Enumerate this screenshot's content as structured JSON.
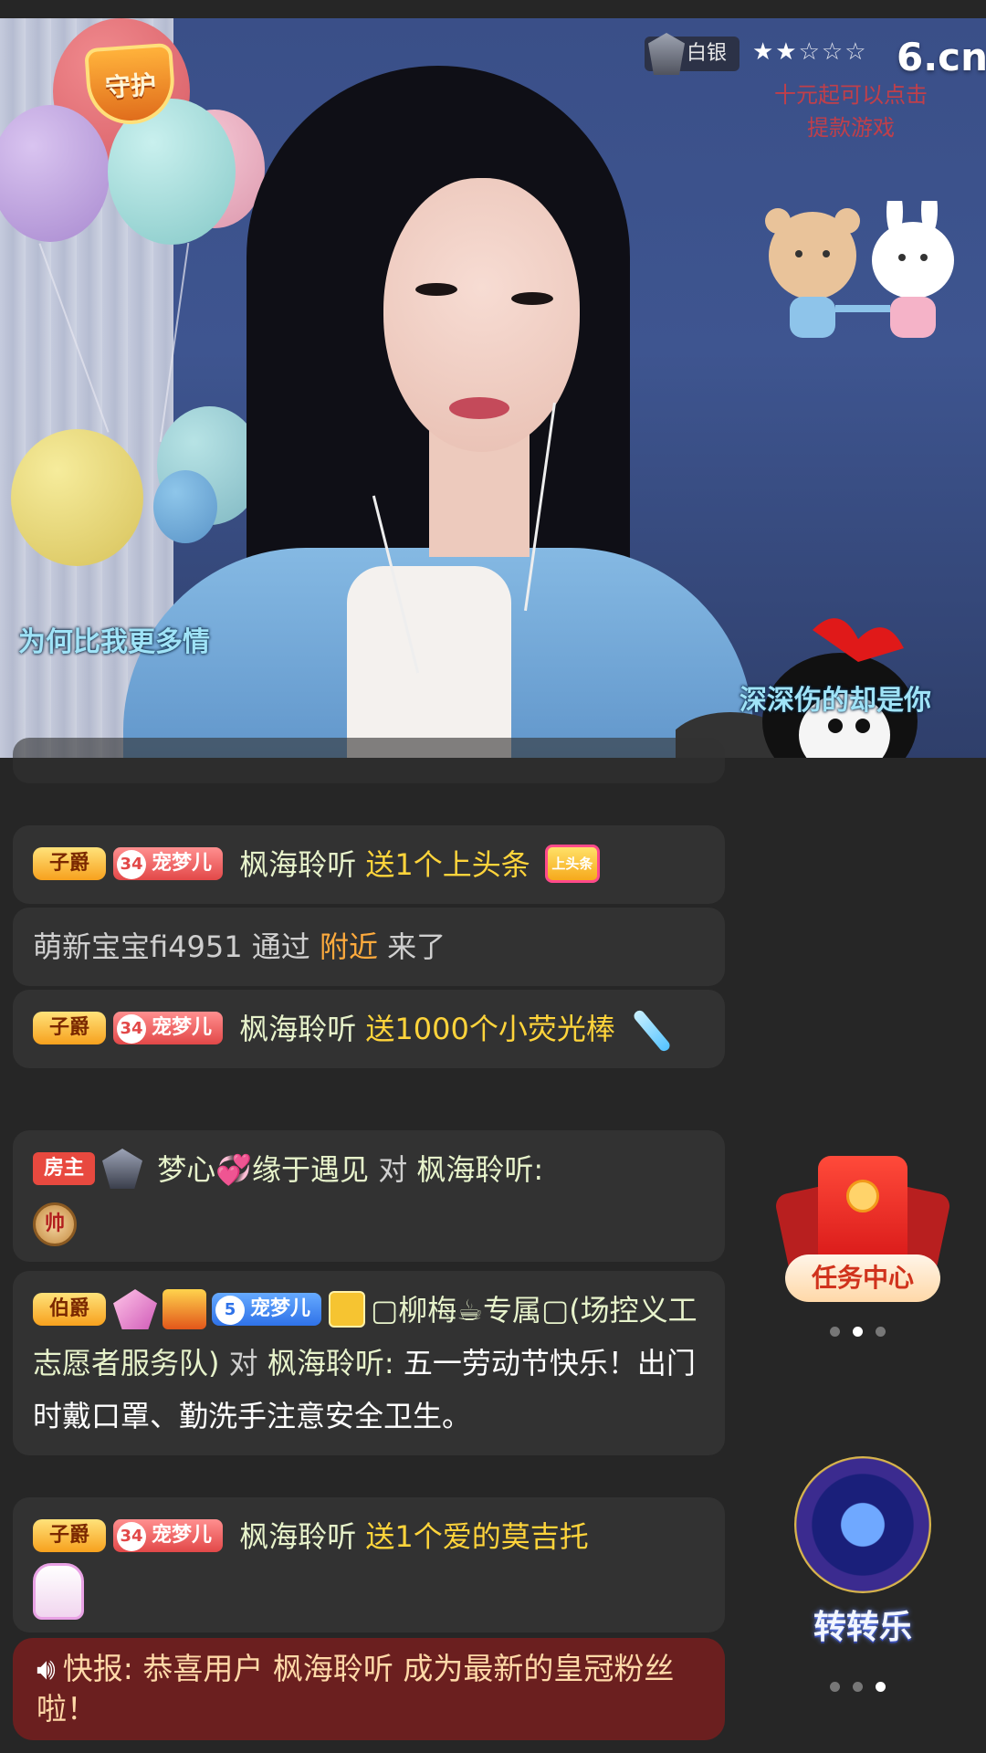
{
  "video": {
    "guard_badge": "守护",
    "level_badge": "白银",
    "stars": {
      "filled": "★★",
      "empty": "☆☆☆"
    },
    "logo": "6.cn",
    "watermark": "十元起可以点击提款游戏",
    "lyric_left": "为何比我更多情",
    "lyric_right": "深深伤的却是你"
  },
  "chat": {
    "messages": [
      {
        "rank": "子爵",
        "fan_level": "34",
        "fan_name": "宠梦儿",
        "user": "枫海聆听",
        "text": "送1个上头条",
        "gift_icon": "上头条"
      },
      {
        "user": "萌新宝宝fi4951",
        "text_before": "通过",
        "highlight": "附近",
        "text_after": "来了"
      },
      {
        "rank": "子爵",
        "fan_level": "34",
        "fan_name": "宠梦儿",
        "user": "枫海聆听",
        "text": "送1000个小荧光棒"
      },
      {
        "host_badge": "房主",
        "user": "梦心💞缘于遇见",
        "to": "对",
        "target": "枫海聆听:",
        "emoji": "帅"
      },
      {
        "rank": "伯爵",
        "fan_level": "5",
        "fan_name": "宠梦儿",
        "user": "▢柳梅☕专属▢(场控义工志愿者服务队)",
        "to": "对",
        "target": "枫海聆听:",
        "text": "五一劳动节快乐！出门时戴口罩、勤洗手注意安全卫生。"
      },
      {
        "rank": "子爵",
        "fan_level": "34",
        "fan_name": "宠梦儿",
        "user": "枫海聆听",
        "text": "送1个爱的莫吉托"
      }
    ]
  },
  "notice": {
    "icon": "speaker-icon",
    "text": "快报: 恭喜用户 枫海聆听 成为最新的皇冠粉丝啦！"
  },
  "widgets": {
    "task_center": "任务中心",
    "lucky_wheel": "转转乐"
  }
}
